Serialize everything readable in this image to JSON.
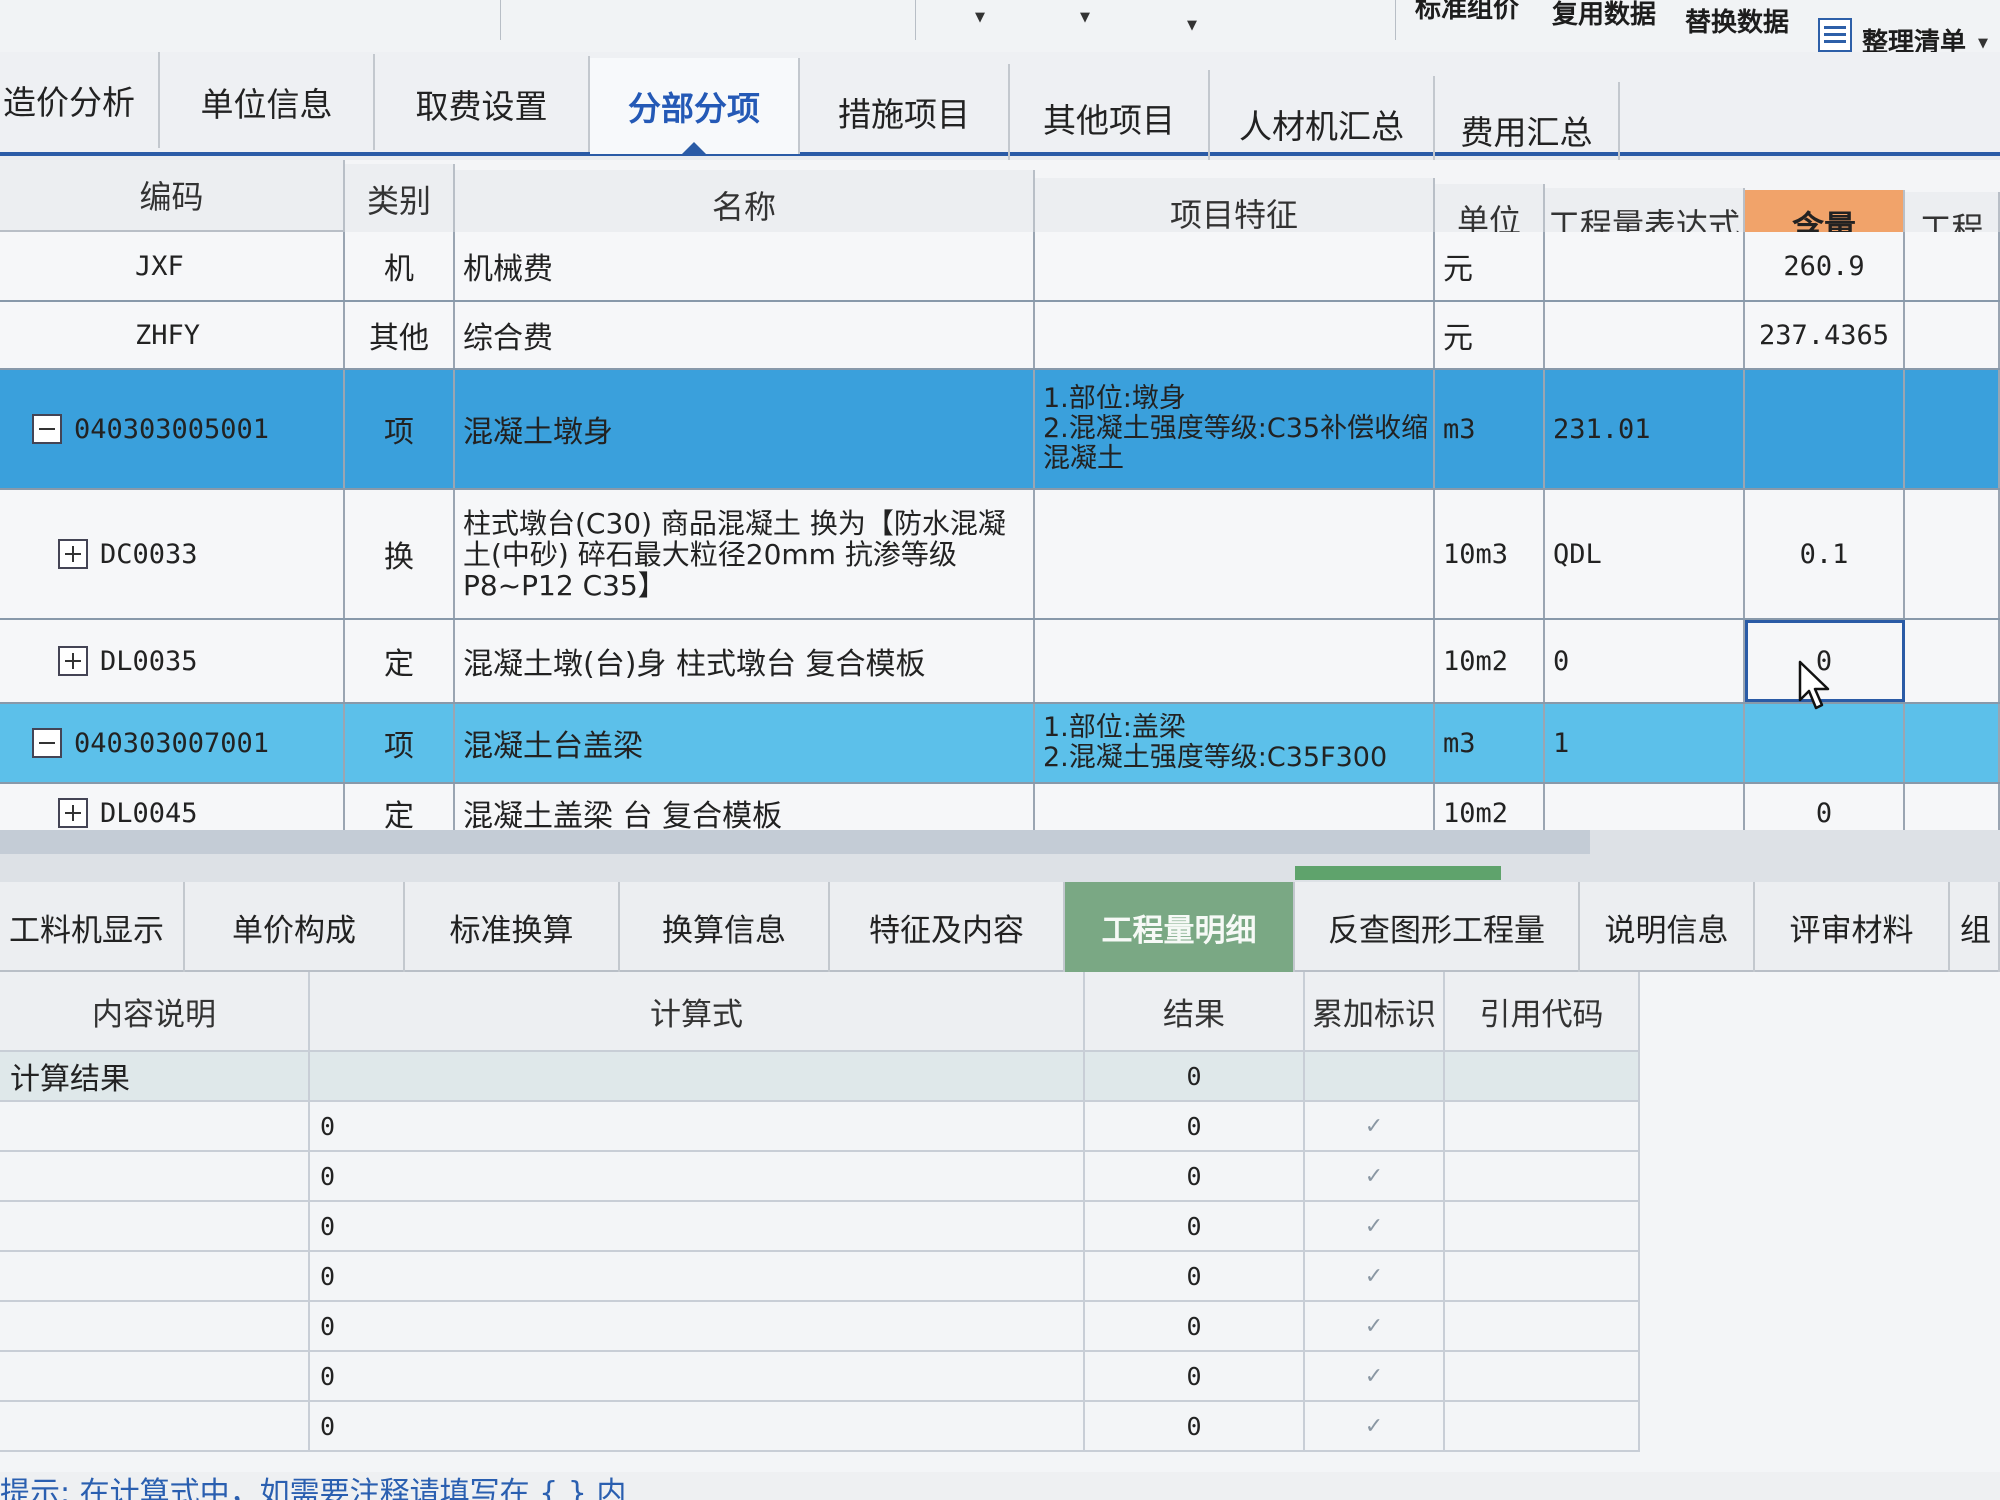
{
  "toolbar": {
    "buttons": [
      "标准组价",
      "复用数据",
      "替换数据",
      "整理清单"
    ],
    "list_icon": "list-icon"
  },
  "main_tabs": [
    {
      "label": "造价分析"
    },
    {
      "label": "单位信息"
    },
    {
      "label": "取费设置"
    },
    {
      "label": "分部分项",
      "active": true
    },
    {
      "label": "措施项目"
    },
    {
      "label": "其他项目"
    },
    {
      "label": "人材机汇总"
    },
    {
      "label": "费用汇总"
    }
  ],
  "upper_table": {
    "columns": [
      "编码",
      "类别",
      "名称",
      "项目特征",
      "单位",
      "工程量表达式",
      "含量",
      "工程"
    ],
    "rows": [
      {
        "code": "JXF",
        "type": "机",
        "name": "机械费",
        "feature": "",
        "unit": "元",
        "expr": "",
        "content": "260.9"
      },
      {
        "code": "ZHFY",
        "type": "其他",
        "name": "综合费",
        "feature": "",
        "unit": "元",
        "expr": "",
        "content": "237.4365"
      },
      {
        "code": "040303005001",
        "type": "项",
        "name": "混凝土墩身",
        "feature": "1.部位:墩身\n2.混凝土强度等级:C35补偿收缩混凝土",
        "unit": "m3",
        "expr": "231.01",
        "content": ""
      },
      {
        "code": "DC0033",
        "type": "换",
        "name": "柱式墩台(C30) 商品混凝土 换为【防水混凝土(中砂) 碎石最大粒径20mm 抗渗等级P8~P12 C35】",
        "feature": "",
        "unit": "10m3",
        "expr": "QDL",
        "content": "0.1"
      },
      {
        "code": "DL0035",
        "type": "定",
        "name": "混凝土墩(台)身 柱式墩台 复合模板",
        "feature": "",
        "unit": "10m2",
        "expr": "0",
        "content": "0"
      },
      {
        "code": "040303007001",
        "type": "项",
        "name": "混凝土台盖梁",
        "feature": "1.部位:盖梁\n2.混凝土强度等级:C35F300",
        "unit": "m3",
        "expr": "1",
        "content": ""
      },
      {
        "code": "DL0045",
        "type": "定",
        "name": "混凝土盖梁 台 复合模板",
        "feature": "",
        "unit": "10m2",
        "expr": "",
        "content": "0"
      }
    ]
  },
  "bottom_tabs": [
    {
      "label": "工料机显示"
    },
    {
      "label": "单价构成"
    },
    {
      "label": "标准换算"
    },
    {
      "label": "换算信息"
    },
    {
      "label": "特征及内容"
    },
    {
      "label": "工程量明细",
      "active": true
    },
    {
      "label": "反查图形工程量"
    },
    {
      "label": "说明信息"
    },
    {
      "label": "评审材料"
    },
    {
      "label": "组"
    }
  ],
  "lower_table": {
    "columns": [
      "内容说明",
      "计算式",
      "结果",
      "累加标识",
      "引用代码"
    ],
    "rows": [
      {
        "desc": "计算结果",
        "formula": "",
        "result": "0",
        "accum": ""
      },
      {
        "desc": "",
        "formula": "0",
        "result": "0",
        "accum": "✓"
      },
      {
        "desc": "",
        "formula": "0",
        "result": "0",
        "accum": "✓"
      },
      {
        "desc": "",
        "formula": "0",
        "result": "0",
        "accum": "✓"
      },
      {
        "desc": "",
        "formula": "0",
        "result": "0",
        "accum": "✓"
      },
      {
        "desc": "",
        "formula": "0",
        "result": "0",
        "accum": "✓"
      },
      {
        "desc": "",
        "formula": "0",
        "result": "0",
        "accum": "✓"
      },
      {
        "desc": "",
        "formula": "0",
        "result": "0",
        "accum": "✓"
      }
    ]
  },
  "status": {
    "text": "提示: 在计算式中，如需要注释请填写在 { } 内"
  },
  "colors": {
    "accent": "#2a5ba6",
    "selected_row": "#3aa0dc",
    "highlight_header": "#f1a36a",
    "active_bottom_tab": "#7aa884"
  }
}
